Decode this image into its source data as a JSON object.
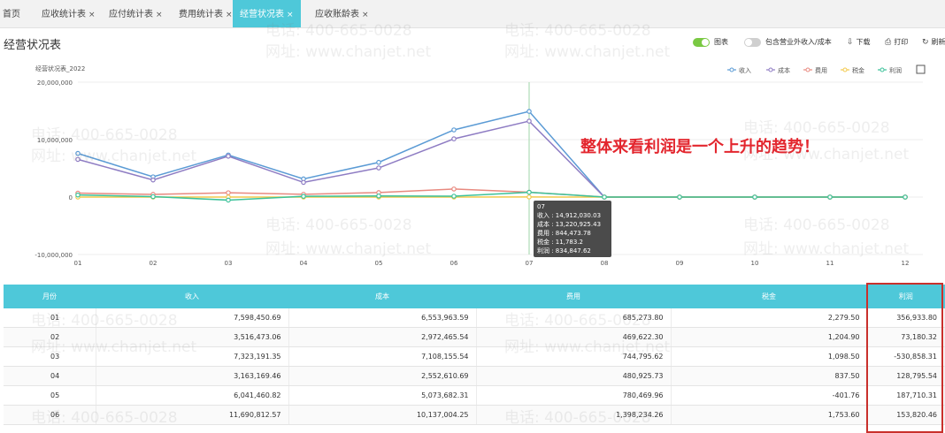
{
  "tabs": [
    {
      "label": "首页",
      "closable": false,
      "active": false
    },
    {
      "label": "应收统计表",
      "closable": true,
      "active": false
    },
    {
      "label": "应付统计表",
      "closable": true,
      "active": false
    },
    {
      "label": "费用统计表",
      "closable": true,
      "active": false
    },
    {
      "label": "经营状况表",
      "closable": true,
      "active": true
    },
    {
      "label": "应收账龄表",
      "closable": true,
      "active": false
    }
  ],
  "tab_close_glyph": "×",
  "page_title": "经营状况表",
  "toolbar": {
    "chart_toggle_label": "图表",
    "chart_toggle_on": true,
    "include_label": "包含营业外收入/成本",
    "include_on": false,
    "download_label": "下载",
    "print_label": "打印",
    "refresh_label": "刷新"
  },
  "chart_data": {
    "type": "line",
    "title": "经营状况表_2022",
    "categories": [
      "01",
      "02",
      "03",
      "04",
      "05",
      "06",
      "07",
      "08",
      "09",
      "10",
      "11",
      "12"
    ],
    "y_ticks": [
      "20,000,000",
      "10,000,000",
      "0",
      "-10,000,000"
    ],
    "ylim": [
      -10000000,
      20000000
    ],
    "legend_position": "top-right",
    "series": [
      {
        "name": "收入",
        "color": "#5b9bd5",
        "values": [
          7598450.69,
          3516473.06,
          7323191.35,
          3163169.46,
          6041460.82,
          11690812.57,
          14912030.03,
          0,
          0,
          0,
          0,
          0
        ]
      },
      {
        "name": "成本",
        "color": "#8e7cc3",
        "values": [
          6553963.59,
          2972465.54,
          7108155.54,
          2552610.69,
          5073682.31,
          10137004.25,
          13220925.43,
          0,
          0,
          0,
          0,
          0
        ]
      },
      {
        "name": "费用",
        "color": "#e8897f",
        "values": [
          685273.8,
          469622.3,
          744795.62,
          480925.73,
          780469.96,
          1398234.26,
          844473.78,
          0,
          0,
          0,
          0,
          0
        ]
      },
      {
        "name": "税金",
        "color": "#f2c94c",
        "values": [
          2279.5,
          1204.9,
          1098.5,
          837.5,
          -401.76,
          1753.6,
          11783.2,
          0,
          0,
          0,
          0,
          0
        ]
      },
      {
        "name": "利润",
        "color": "#3cc29a",
        "values": [
          356933.8,
          73180.32,
          -530858.31,
          128795.54,
          187710.31,
          153820.46,
          834847.62,
          0,
          0,
          0,
          0,
          0
        ]
      }
    ],
    "tooltip": {
      "month": "07",
      "lines": [
        "收入 : 14,912,030.03",
        "成本 : 13,220,925.43",
        "费用 : 844,473.78",
        "税金 : 11,783.2",
        "利润 : 834,847.62"
      ]
    },
    "annotation": "整体来看利润是一个上升的趋势！"
  },
  "table": {
    "headers": [
      "月份",
      "收入",
      "成本",
      "费用",
      "税金",
      "利润"
    ],
    "rows": [
      [
        "01",
        "7,598,450.69",
        "6,553,963.59",
        "685,273.80",
        "2,279.50",
        "356,933.80"
      ],
      [
        "02",
        "3,516,473.06",
        "2,972,465.54",
        "469,622.30",
        "1,204.90",
        "73,180.32"
      ],
      [
        "03",
        "7,323,191.35",
        "7,108,155.54",
        "744,795.62",
        "1,098.50",
        "-530,858.31"
      ],
      [
        "04",
        "3,163,169.46",
        "2,552,610.69",
        "480,925.73",
        "837.50",
        "128,795.54"
      ],
      [
        "05",
        "6,041,460.82",
        "5,073,682.31",
        "780,469.96",
        "-401.76",
        "187,710.31"
      ],
      [
        "06",
        "11,690,812.57",
        "10,137,004.25",
        "1,398,234.26",
        "1,753.60",
        "153,820.46"
      ]
    ]
  },
  "watermark": {
    "phone": "电话: 400-665-0028",
    "site": "网址: www.chanjet.net"
  }
}
